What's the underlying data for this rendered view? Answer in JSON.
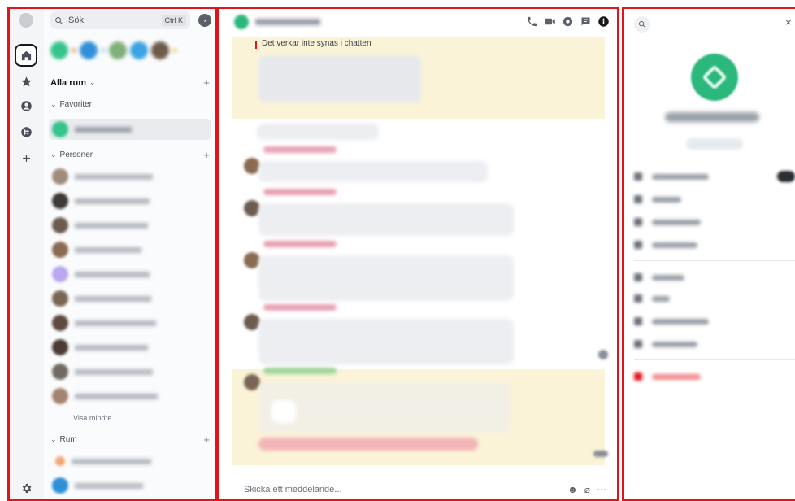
{
  "roomlist": {
    "search_placeholder": "Sök",
    "search_shortcut": "Ctrl K",
    "all_rooms_label": "Alla rum",
    "favorites_label": "Favoriter",
    "people_label": "Personer",
    "show_less_label": "Visa mindre",
    "rooms_label": "Rum"
  },
  "chat": {
    "visible_message": "Det verkar inte synas i chatten",
    "composer_placeholder": "Skicka ett meddelande..."
  },
  "colors": {
    "accent_green": "#2bb87c",
    "frame_red": "#e3131b",
    "highlight_yellow": "#fbf3d7"
  },
  "icons": {
    "spacebar": [
      "home-icon",
      "star-icon",
      "person-icon",
      "hash-icon",
      "plus-icon",
      "gear-icon"
    ],
    "header": [
      "phone-icon",
      "video-icon",
      "threads-icon",
      "room-info-icon",
      "info-icon"
    ],
    "composer": [
      "emoji-icon",
      "attachment-icon",
      "more-icon"
    ]
  }
}
